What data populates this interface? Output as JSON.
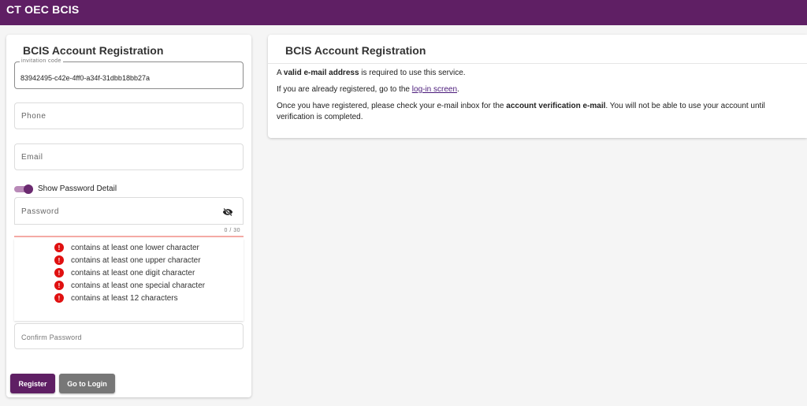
{
  "app": {
    "title": "CT OEC BCIS"
  },
  "form": {
    "title": "BCIS Account Registration",
    "invitation": {
      "label": "invitation code",
      "value": "83942495-c42e-4ff0-a34f-31dbb18bb27a"
    },
    "phone": {
      "label": "Phone"
    },
    "email": {
      "label": "Email"
    },
    "show_password_toggle": {
      "label": "Show Password Detail"
    },
    "password": {
      "label": "Password",
      "counter": "0 / 30",
      "icon": "eye-off-icon"
    },
    "rules": [
      {
        "text": "contains at least one lower character",
        "icon": "!"
      },
      {
        "text": "contains at least one upper character",
        "icon": "!"
      },
      {
        "text": "contains at least one digit character",
        "icon": "!"
      },
      {
        "text": "contains at least one special character",
        "icon": "!"
      },
      {
        "text": "contains at least 12 characters",
        "icon": "!"
      }
    ],
    "confirm_password": {
      "label": "Confirm Password"
    },
    "buttons": {
      "register": "Register",
      "go_to_login": "Go to Login"
    }
  },
  "info": {
    "title": "BCIS Account Registration",
    "p1": {
      "pre": "A ",
      "bold": "valid e-mail address",
      "post": " is required to use this service."
    },
    "p2": {
      "pre": "If you are already registered, go to the ",
      "link": "log-in screen",
      "post": "."
    },
    "p3": {
      "pre": "Once you have registered, please check your e-mail inbox for the ",
      "bold": "account verification e-mail",
      "post": ". You will not be able to use your account until verification is completed."
    }
  },
  "colors": {
    "brand": "#5f1f64",
    "error": "#e01010",
    "secondary_button": "#777777"
  }
}
